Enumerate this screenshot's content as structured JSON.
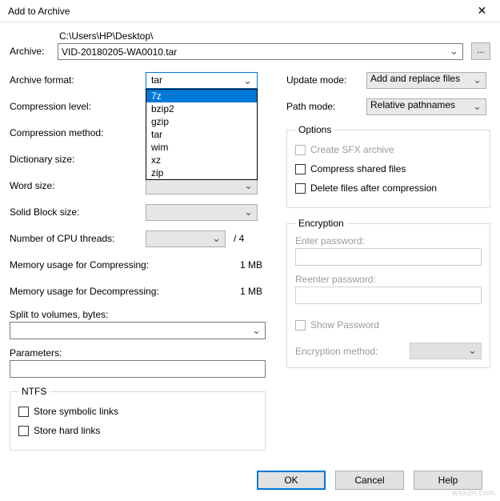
{
  "window": {
    "title": "Add to Archive"
  },
  "archive": {
    "label": "Archive:",
    "path": "C:\\Users\\HP\\Desktop\\",
    "filename": "VID-20180205-WA0010.tar",
    "browse_label": "..."
  },
  "left": {
    "format_label": "Archive format:",
    "format_value": "tar",
    "format_options": [
      "7z",
      "bzip2",
      "gzip",
      "tar",
      "wim",
      "xz",
      "zip"
    ],
    "format_highlight": "7z",
    "compression_level_label": "Compression level:",
    "compression_method_label": "Compression method:",
    "dictionary_label": "Dictionary size:",
    "word_label": "Word size:",
    "solid_label": "Solid Block size:",
    "cpu_label": "Number of CPU threads:",
    "cpu_total": "/ 4",
    "mem_compress_label": "Memory usage for Compressing:",
    "mem_compress_value": "1 MB",
    "mem_decompress_label": "Memory usage for Decompressing:",
    "mem_decompress_value": "1 MB",
    "split_label": "Split to volumes, bytes:",
    "params_label": "Parameters:",
    "ntfs_legend": "NTFS",
    "ntfs_symlinks": "Store symbolic links",
    "ntfs_hardlinks": "Store hard links"
  },
  "right": {
    "update_label": "Update mode:",
    "update_value": "Add and replace files",
    "path_label": "Path mode:",
    "path_value": "Relative pathnames",
    "options_legend": "Options",
    "opt_sfx": "Create SFX archive",
    "opt_shared": "Compress shared files",
    "opt_delete": "Delete files after compression",
    "enc_legend": "Encryption",
    "enc_enter": "Enter password:",
    "enc_reenter": "Reenter password:",
    "enc_show": "Show Password",
    "enc_method_label": "Encryption method:"
  },
  "footer": {
    "ok": "OK",
    "cancel": "Cancel",
    "help": "Help"
  },
  "watermark": "wsxdn.com"
}
